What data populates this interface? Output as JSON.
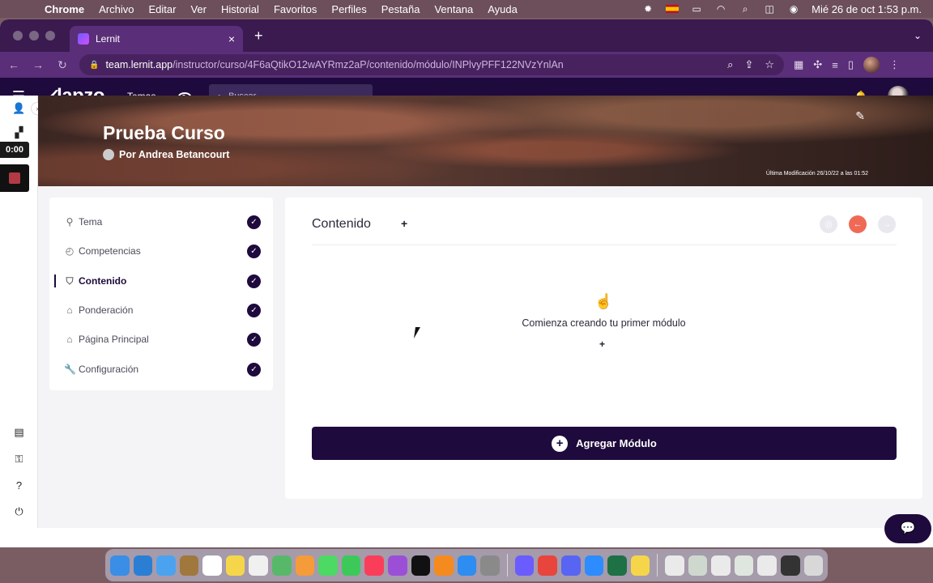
{
  "menubar": {
    "apple": "",
    "items": [
      "Chrome",
      "Archivo",
      "Editar",
      "Ver",
      "Historial",
      "Favoritos",
      "Perfiles",
      "Pestaña",
      "Ventana",
      "Ayuda"
    ],
    "clock": "Mié 26 de oct  1:53 p.m."
  },
  "browser": {
    "tab_title": "Lernit",
    "url_host": "team.lernit.app",
    "url_path": "/instructor/curso/4F6aQtikO12wAYRmz2aP/contenido/módulo/INPlvyPFF122NVzYnlAn"
  },
  "appbar": {
    "logo": "lapzo",
    "nav_temas": "Temas",
    "search_placeholder": "Buscar"
  },
  "rail": {
    "timer": "0:00"
  },
  "banner": {
    "title": "Prueba Curso",
    "author": "Por Andrea Betancourt",
    "last_modified": "Última Modificación 26/10/22 a las 01:52"
  },
  "steps": [
    {
      "label": "Tema",
      "icon": "pin-icon"
    },
    {
      "label": "Competencias",
      "icon": "compass-icon"
    },
    {
      "label": "Contenido",
      "icon": "shield-icon"
    },
    {
      "label": "Ponderación",
      "icon": "bell-icon"
    },
    {
      "label": "Página Principal",
      "icon": "home-icon"
    },
    {
      "label": "Configuración",
      "icon": "wrench-icon"
    }
  ],
  "main": {
    "title": "Contenido",
    "add": "+",
    "empty_icon": "☝️",
    "empty_text": "Comienza creando tu primer módulo",
    "empty_plus": "+",
    "add_module_label": "Agregar Módulo"
  },
  "colors": {
    "primary": "#1e0a3c",
    "accent": "#ef6a55"
  }
}
